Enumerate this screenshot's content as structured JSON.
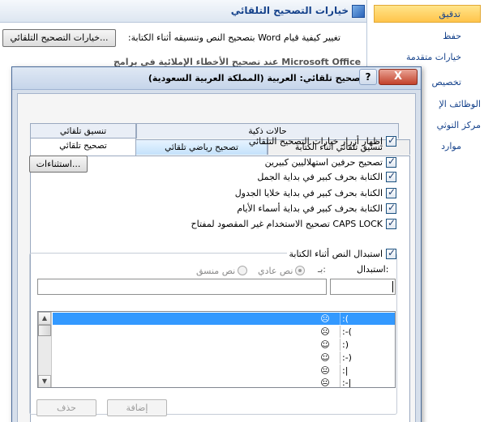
{
  "background": {
    "header_title": "خيارات التصحيح التلقائي",
    "description": "تغيير كيفية قيام Word بتصحيح النص وتنسيقه أثناء الكتابة:",
    "autocorrect_options_button": "خيارات التصحيح التلقائي...",
    "partial_text": "عند تصحيح الأخطاء الإملائية في برامج Microsoft Office"
  },
  "sidebar": {
    "items": [
      {
        "label": "تدقيق",
        "active": true
      },
      {
        "label": "حفظ"
      },
      {
        "label": "خيارات متقدمة"
      },
      {
        "label": "تخصيص"
      },
      {
        "label": "الوظائف الإ"
      },
      {
        "label": "مركز التوثي"
      },
      {
        "label": "موارد"
      }
    ]
  },
  "dialog": {
    "title": "تصحيح تلقائي: العربية (المملكة العربية السعودية)",
    "help_label": "?",
    "close_label": "X",
    "tabs_row1": [
      "حالات ذكية",
      "تنسيق تلقائي"
    ],
    "tabs_row2": [
      "تنسيق تلقائي أثناء الكتابة",
      "تصحيح رياضي تلقائي",
      "تصحيح تلقائي"
    ],
    "show_buttons_label": "إظهار أزرار خيارات التصحيح التلقائي",
    "options": [
      "تصحيح حرفين استهلاليين كبيرين",
      "الكتابة بحرف كبير في بداية الجمل",
      "الكتابة بحرف كبير في بداية خلايا الجدول",
      "الكتابة بحرف كبير في بداية أسماء الأيام",
      "تصحيح الاستخدام غير المقصود لمفتاح CAPS LOCK"
    ],
    "exceptions_button": "استثناءات...",
    "replace_text_label": "استبدال النص أثناء الكتابة",
    "replace_label": "استبدال:",
    "with_label": "بـ:",
    "plain_text_option": "نص عادي",
    "formatted_text_option": "نص منسق",
    "replace_value": "",
    "with_value": "",
    "rows": [
      {
        "replace": ":(",
        "with": "☹",
        "selected": true
      },
      {
        "replace": ":-(",
        "with": "☹"
      },
      {
        "replace": ":)",
        "with": "☺"
      },
      {
        "replace": ":-)",
        "with": "☺"
      },
      {
        "replace": ":|",
        "with": "😐"
      },
      {
        "replace": ":-|",
        "with": "😐"
      }
    ],
    "add_button": "إضافة",
    "delete_button": "حذف"
  }
}
